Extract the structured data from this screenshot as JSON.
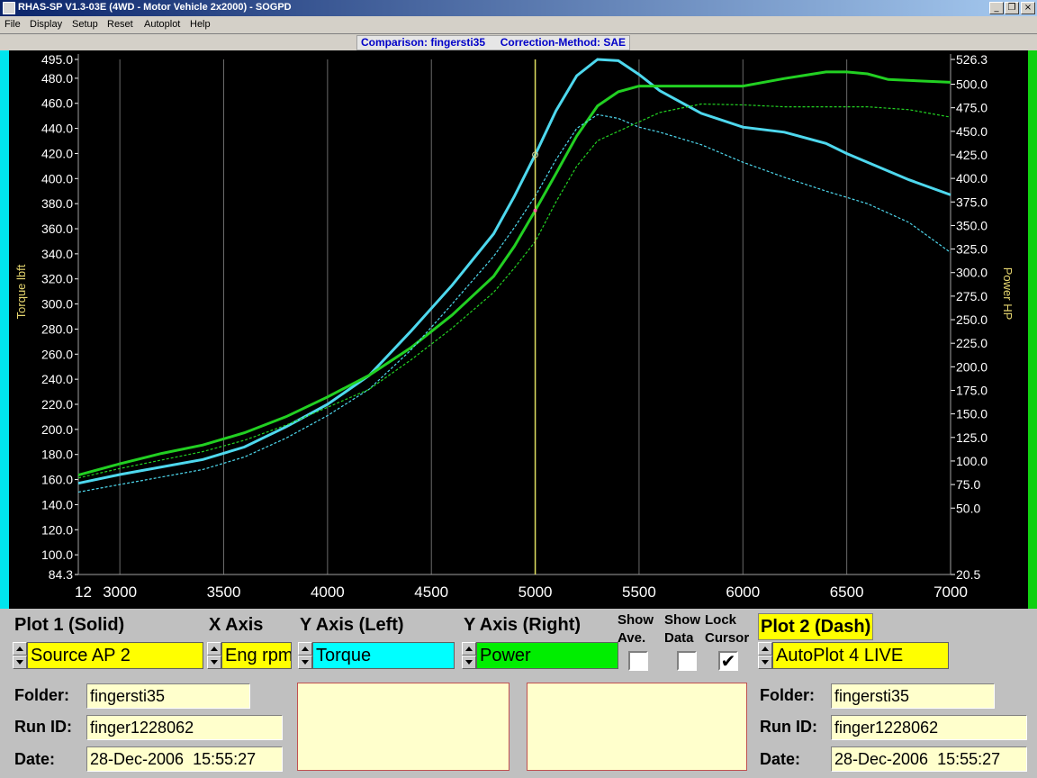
{
  "window": {
    "title": "RHAS-SP V1.3-03E  (4WD - Motor Vehicle 2x2000) - SOGPD",
    "minimize_glyph": "_",
    "restore_glyph": "❐",
    "close_glyph": "×"
  },
  "menu": [
    "File",
    "Display",
    "Setup",
    "Reset",
    "Autoplot",
    "Help"
  ],
  "subtitle": "Comparison: fingersti35     Correction-Method: SAE",
  "chart_data": {
    "type": "line",
    "xlim": [
      2800,
      7000
    ],
    "x_ticks": [
      3000,
      3500,
      4000,
      4500,
      5000,
      5500,
      6000,
      6500,
      7000
    ],
    "x_tick_labels": [
      "3000",
      "3500",
      "4000",
      "4500",
      "5000",
      "5500",
      "6000",
      "6500",
      "7000"
    ],
    "x_left_label": "12",
    "ylabel_left": "Torque  lbft",
    "ylim_left": [
      84.3,
      495.0
    ],
    "y_left_tick_labels": [
      "495.0",
      "480.0",
      "460.0",
      "440.0",
      "420.0",
      "400.0",
      "380.0",
      "360.0",
      "340.0",
      "320.0",
      "300.0",
      "280.0",
      "260.0",
      "240.0",
      "220.0",
      "200.0",
      "180.0",
      "160.0",
      "140.0",
      "120.0",
      "100.0",
      "84.3"
    ],
    "ylabel_right": "Power  HP",
    "ylim_right": [
      -20.5,
      526.3
    ],
    "y_right_tick_labels": [
      "526.3",
      "500.0",
      "475.0",
      "450.0",
      "425.0",
      "400.0",
      "375.0",
      "350.0",
      "325.0",
      "300.0",
      "275.0",
      "250.0",
      "225.0",
      "200.0",
      "175.0",
      "150.0",
      "125.0",
      "100.0",
      "75.0",
      "50.0",
      "20.5"
    ],
    "cursor_x": 5000,
    "grid": true,
    "colors": {
      "torque": "#4ed8ee",
      "power": "#22d022",
      "cursor": "#e0e060",
      "grid": "#6a6a6a",
      "tick_text": "#ffffff",
      "axis_label": "#e8d870"
    },
    "series": [
      {
        "axis": "left",
        "color": "#4ed8ee",
        "style": "solid",
        "x": [
          2800,
          3000,
          3200,
          3400,
          3600,
          3800,
          4000,
          4200,
          4400,
          4600,
          4800,
          4900,
          5000,
          5100,
          5200,
          5300,
          5400,
          5500,
          5600,
          5800,
          6000,
          6200,
          6400,
          6500,
          6600,
          6800,
          7000
        ],
        "y": [
          157,
          164,
          170,
          176,
          186,
          202,
          220,
          243,
          278,
          315,
          356,
          386,
          419,
          454,
          482,
          495,
          494,
          483,
          470,
          452,
          441,
          437,
          428,
          420,
          413,
          399,
          387
        ]
      },
      {
        "axis": "right",
        "color": "#22d022",
        "style": "solid",
        "x": [
          2800,
          3000,
          3200,
          3400,
          3600,
          3800,
          4000,
          4200,
          4400,
          4600,
          4800,
          4900,
          5000,
          5100,
          5200,
          5300,
          5400,
          5500,
          5700,
          6000,
          6200,
          6400,
          6500,
          6600,
          6700,
          7000
        ],
        "y": [
          85,
          97,
          108,
          117,
          130,
          147,
          168,
          191,
          220,
          255,
          296,
          328,
          366,
          405,
          445,
          477,
          492,
          498,
          498,
          498,
          506,
          513,
          513,
          511,
          505,
          502
        ]
      },
      {
        "axis": "left",
        "color": "#4ed8ee",
        "style": "dashed",
        "x": [
          2800,
          3000,
          3200,
          3400,
          3600,
          3800,
          4000,
          4200,
          4400,
          4600,
          4800,
          4900,
          5000,
          5100,
          5200,
          5300,
          5400,
          5500,
          5600,
          5800,
          6000,
          6200,
          6400,
          6600,
          6800,
          7000
        ],
        "y": [
          150,
          156,
          162,
          168,
          178,
          193,
          211,
          232,
          263,
          300,
          338,
          361,
          386,
          415,
          440,
          451,
          448,
          441,
          437,
          427,
          413,
          401,
          390,
          380,
          365,
          341
        ]
      },
      {
        "axis": "right",
        "color": "#22d022",
        "style": "dashed",
        "x": [
          2800,
          3000,
          3200,
          3400,
          3600,
          3800,
          4000,
          4200,
          4400,
          4600,
          4800,
          4900,
          5000,
          5100,
          5200,
          5300,
          5400,
          5500,
          5600,
          5800,
          6000,
          6200,
          6400,
          6600,
          6800,
          7000
        ],
        "y": [
          82,
          92,
          101,
          110,
          122,
          138,
          157,
          176,
          207,
          241,
          279,
          305,
          333,
          375,
          413,
          440,
          450,
          460,
          470,
          479,
          478,
          476,
          476,
          476,
          473,
          465
        ]
      }
    ]
  },
  "panel": {
    "plot1_label": "Plot 1 (Solid)",
    "xaxis_label": "X Axis",
    "yleft_label": "Y Axis (Left)",
    "yright_label": "Y Axis (Right)",
    "plot2_label": "Plot 2 (Dash)",
    "plot1_source": "Source AP 2",
    "xaxis_value": "Eng rpm",
    "yleft_value": "Torque",
    "yright_value": "Power",
    "plot2_source": "AutoPlot 4 LIVE",
    "show_ave_label": "Show Ave.",
    "show_data_label": "Show Data",
    "lock_cursor_label": "Lock Cursor",
    "show_ave_checked": false,
    "show_data_checked": false,
    "lock_cursor_checked": true,
    "check_glyph": "✔",
    "folder_label": "Folder:",
    "runid_label": "Run ID:",
    "date_label": "Date:",
    "plot1_folder": "fingersti35",
    "plot1_runid": "finger1228062",
    "plot1_date": "28-Dec-2006  15:55:27",
    "plot2_folder": "fingersti35",
    "plot2_runid": "finger1228062",
    "plot2_date": "28-Dec-2006  15:55:27",
    "colors": {
      "yellow": "#ffff00",
      "cyan": "#00ffff",
      "green": "#00ee00",
      "field": "#ffffcc"
    }
  }
}
